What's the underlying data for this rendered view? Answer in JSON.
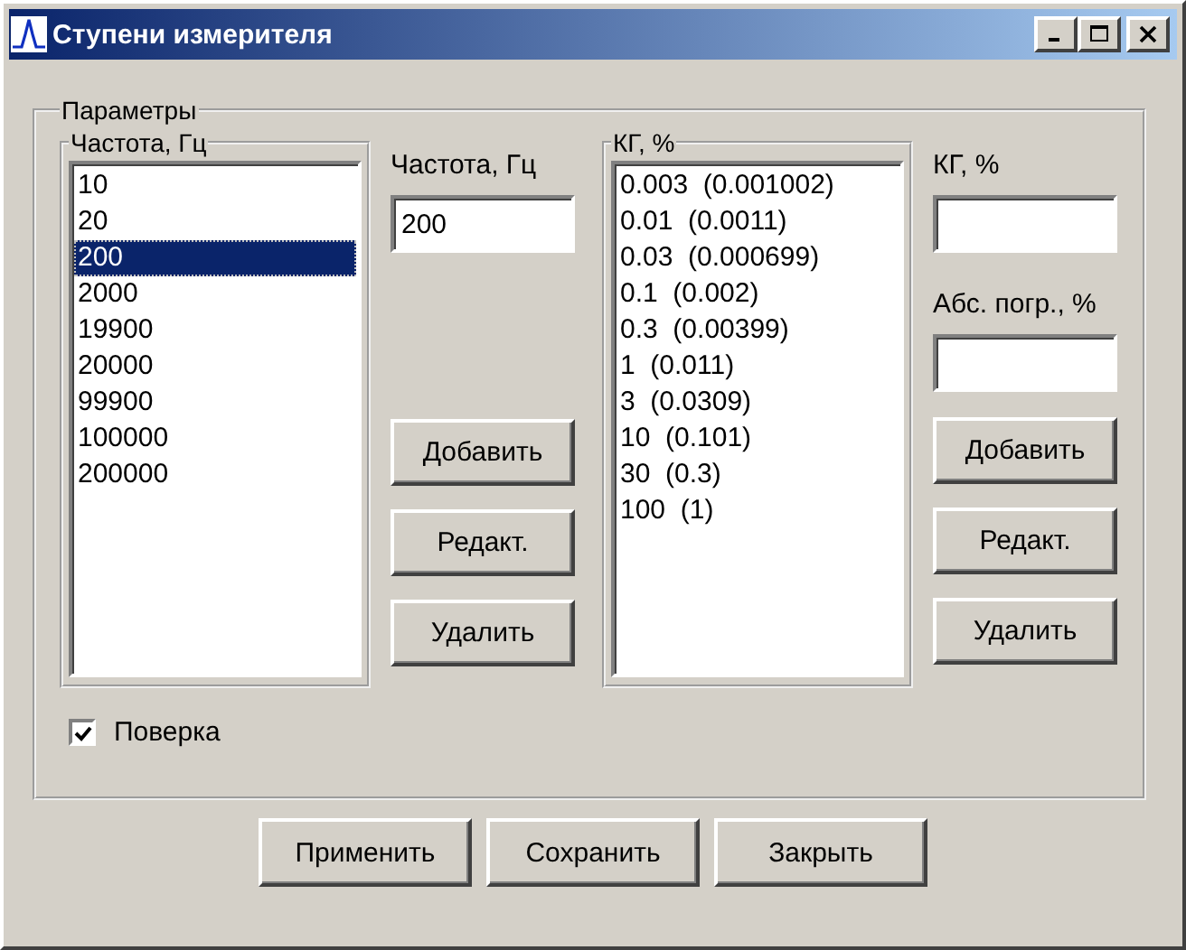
{
  "window": {
    "title": "Ступени измерителя"
  },
  "group": {
    "title": "Параметры"
  },
  "frequency_list": {
    "title": "Частота, Гц",
    "items": [
      {
        "label": "10",
        "selected": false
      },
      {
        "label": "20",
        "selected": false
      },
      {
        "label": "200",
        "selected": true
      },
      {
        "label": "2000",
        "selected": false
      },
      {
        "label": "19900",
        "selected": false
      },
      {
        "label": "20000",
        "selected": false
      },
      {
        "label": "99900",
        "selected": false
      },
      {
        "label": "100000",
        "selected": false
      },
      {
        "label": "200000",
        "selected": false
      }
    ]
  },
  "frequency_field": {
    "label": "Частота, Гц",
    "value": "200"
  },
  "frequency_buttons": [
    "Добавить",
    "Редакт.",
    "Удалить"
  ],
  "kg_list": {
    "title": "КГ, %",
    "items": [
      {
        "label": "0.003  (0.001002)",
        "selected": false
      },
      {
        "label": "0.01  (0.0011)",
        "selected": false
      },
      {
        "label": "0.03  (0.000699)",
        "selected": false
      },
      {
        "label": "0.1  (0.002)",
        "selected": false
      },
      {
        "label": "0.3  (0.00399)",
        "selected": false
      },
      {
        "label": "1  (0.011)",
        "selected": false
      },
      {
        "label": "3  (0.0309)",
        "selected": false
      },
      {
        "label": "10  (0.101)",
        "selected": false
      },
      {
        "label": "30  (0.3)",
        "selected": false
      },
      {
        "label": "100  (1)",
        "selected": false
      }
    ]
  },
  "kg_field": {
    "label": "КГ, %"
  },
  "error_field": {
    "label": "Абс. погр., %"
  },
  "kg_buttons": [
    "Добавить",
    "Редакт.",
    "Удалить"
  ],
  "verification": {
    "label": "Поверка",
    "checked": true
  },
  "buttons": [
    "Применить",
    "Сохранить",
    "Закрыть"
  ]
}
